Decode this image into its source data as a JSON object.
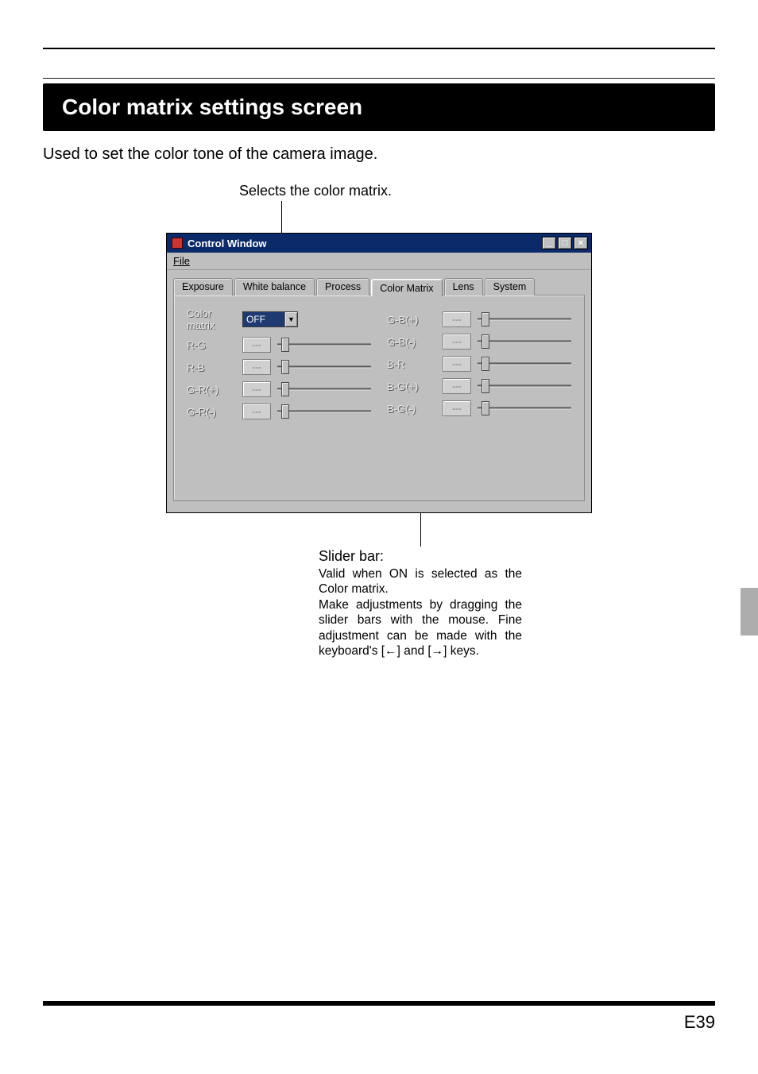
{
  "page": {
    "section_title": "Color matrix settings screen",
    "intro": "Used to set the color tone of the camera image.",
    "caption_select": "Selects the color matrix.",
    "page_number": "E39"
  },
  "window": {
    "title": "Control Window",
    "menu_file": "File",
    "tabs": [
      "Exposure",
      "White balance",
      "Process",
      "Color Matrix",
      "Lens",
      "System"
    ],
    "active_tab_index": 3,
    "color_matrix_label": "Color matrix",
    "color_matrix_value": "OFF",
    "placeholder": "---",
    "left_params": [
      "R-G",
      "R-B",
      "G-R(+)",
      "G-R(-)"
    ],
    "right_params": [
      "G-B(+)",
      "G-B(-)",
      "B-R",
      "B-G(+)",
      "B-G(-)"
    ]
  },
  "slider_explain": {
    "heading": "Slider bar:",
    "body1": "Valid when ON is selected as the Color matrix.",
    "body2": "Make adjustments by dragging the slider bars with the mouse. Fine adjustment can be made with the keyboard's [←] and [→] keys."
  }
}
